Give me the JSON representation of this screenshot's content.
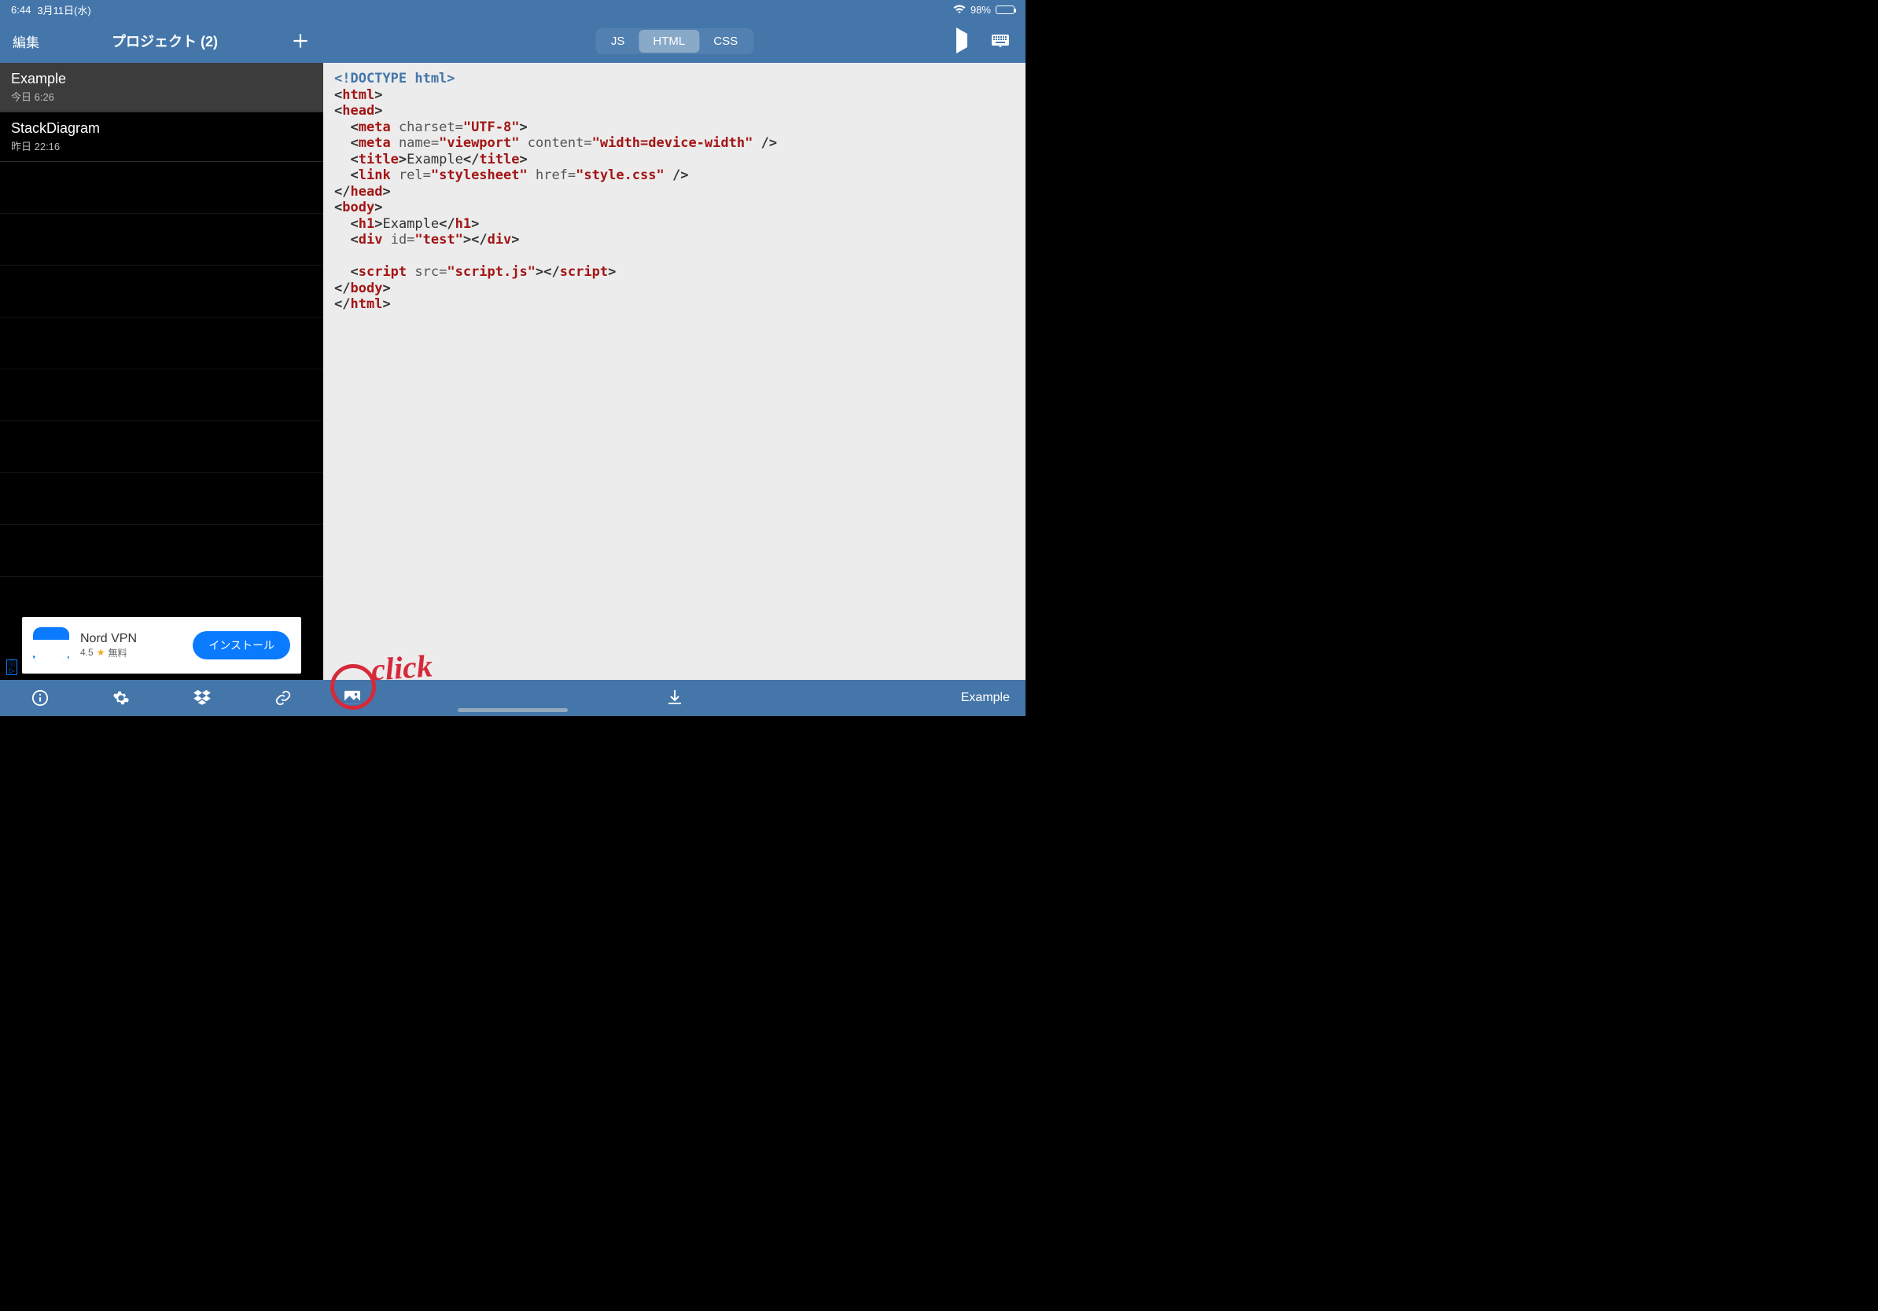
{
  "status": {
    "time": "6:44",
    "date": "3月11日(水)",
    "battery_pct": "98%"
  },
  "sidebar": {
    "edit_label": "編集",
    "title": "プロジェクト (2)",
    "projects": [
      {
        "name": "Example",
        "time": "今日 6:26"
      },
      {
        "name": "StackDiagram",
        "time": "昨日 22:16"
      }
    ]
  },
  "tabs": {
    "js": "JS",
    "html": "HTML",
    "css": "CSS",
    "active": "HTML"
  },
  "ad": {
    "title": "Nord VPN",
    "rating": "4.5",
    "price": "無料",
    "button": "インストール"
  },
  "editor": {
    "lines": [
      {
        "raw": "<!DOCTYPE html>",
        "type": "doctype"
      },
      {
        "open": "html"
      },
      {
        "open": "head"
      },
      {
        "indent": 1,
        "selfclose": "meta",
        "attrs": [
          [
            "charset",
            "UTF-8"
          ]
        ]
      },
      {
        "indent": 1,
        "selfclose": "meta",
        "attrs": [
          [
            "name",
            "viewport"
          ],
          [
            "content",
            "width=device-width"
          ]
        ],
        "trail": " />"
      },
      {
        "indent": 1,
        "wrap": "title",
        "text": "Example"
      },
      {
        "indent": 1,
        "selfclose": "link",
        "attrs": [
          [
            "rel",
            "stylesheet"
          ],
          [
            "href",
            "style.css"
          ]
        ],
        "trail": " />"
      },
      {
        "close": "head"
      },
      {
        "open": "body"
      },
      {
        "indent": 1,
        "wrap": "h1",
        "text": "Example"
      },
      {
        "indent": 1,
        "wrap": "div",
        "attrs": [
          [
            "id",
            "test"
          ]
        ],
        "text": ""
      },
      {
        "blank": true
      },
      {
        "indent": 1,
        "wrap": "script",
        "attrs": [
          [
            "src",
            "script.js"
          ]
        ],
        "text": ""
      },
      {
        "close": "body"
      },
      {
        "close": "html"
      }
    ]
  },
  "bottom": {
    "filename": "Example"
  },
  "annotation": {
    "label": "click"
  }
}
